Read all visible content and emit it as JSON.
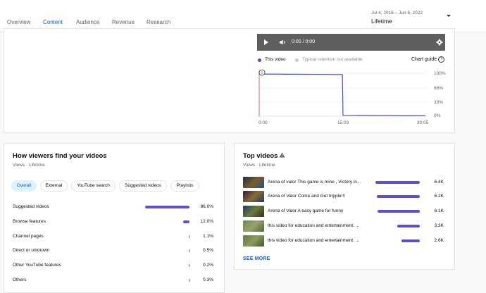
{
  "tabs": [
    {
      "label": "Overview"
    },
    {
      "label": "Content"
    },
    {
      "label": "Audience"
    },
    {
      "label": "Revenue"
    },
    {
      "label": "Research"
    }
  ],
  "date_range": {
    "range": "Jul 4, 2016 – Jun 6, 2022",
    "period": "Lifetime"
  },
  "player": {
    "time": "0:00 / 0:00"
  },
  "retention": {
    "legend_this": "This video",
    "legend_typical": "Typical retention not available",
    "chart_guide": "Chart guide",
    "help": "?",
    "info": "i",
    "accent": "#3f51d8"
  },
  "chart_data": {
    "type": "line",
    "series": [
      {
        "name": "This video",
        "x": [
          "0:00",
          "0:02",
          "15:03",
          "15:10",
          "30:05"
        ],
        "values": [
          98,
          98,
          97,
          2,
          1
        ]
      }
    ],
    "x_ticks": [
      "0:00",
      "15:03",
      "30:05"
    ],
    "y_ticks": [
      "100%",
      "66%",
      "33%",
      "0%"
    ],
    "ylim": [
      0,
      100
    ]
  },
  "viewers": {
    "title": "How viewers find your videos",
    "sub": "Views · Lifetime",
    "chips": [
      {
        "label": "Overall",
        "selected": true
      },
      {
        "label": "External",
        "selected": false
      },
      {
        "label": "YouTube search",
        "selected": false
      },
      {
        "label": "Suggested videos",
        "selected": false
      },
      {
        "label": "Playlists",
        "selected": false
      }
    ],
    "sources": [
      {
        "label": "Suggested videos",
        "value": "86.0%",
        "pct": 86.0
      },
      {
        "label": "Browse features",
        "value": "12.0%",
        "pct": 12.0
      },
      {
        "label": "Channel pages",
        "value": "1.1%",
        "pct": 1.1
      },
      {
        "label": "Direct or unknown",
        "value": "0.5%",
        "pct": 0.5
      },
      {
        "label": "Other YouTube features",
        "value": "0.2%",
        "pct": 0.2
      },
      {
        "label": "Others",
        "value": "0.3%",
        "pct": 0.3
      }
    ]
  },
  "top_videos": {
    "title": "Top videos",
    "sub": "Views · Lifetime",
    "items": [
      {
        "title": "Arena of valor This game is mine , Victory in...",
        "value": "6.4K",
        "views": 6400
      },
      {
        "title": "Arena of Valor Come and Get tripple!!!",
        "value": "6.2K",
        "views": 6200
      },
      {
        "title": "Arena of Valor A easy game for funny",
        "value": "6.1K",
        "views": 6100
      },
      {
        "title": "this video for education and entertainment. ...",
        "value": "3.3K",
        "views": 3300
      },
      {
        "title": "this video for education and entertainment. ...",
        "value": "2.6K",
        "views": 2600
      }
    ],
    "see_more": "SEE MORE"
  }
}
